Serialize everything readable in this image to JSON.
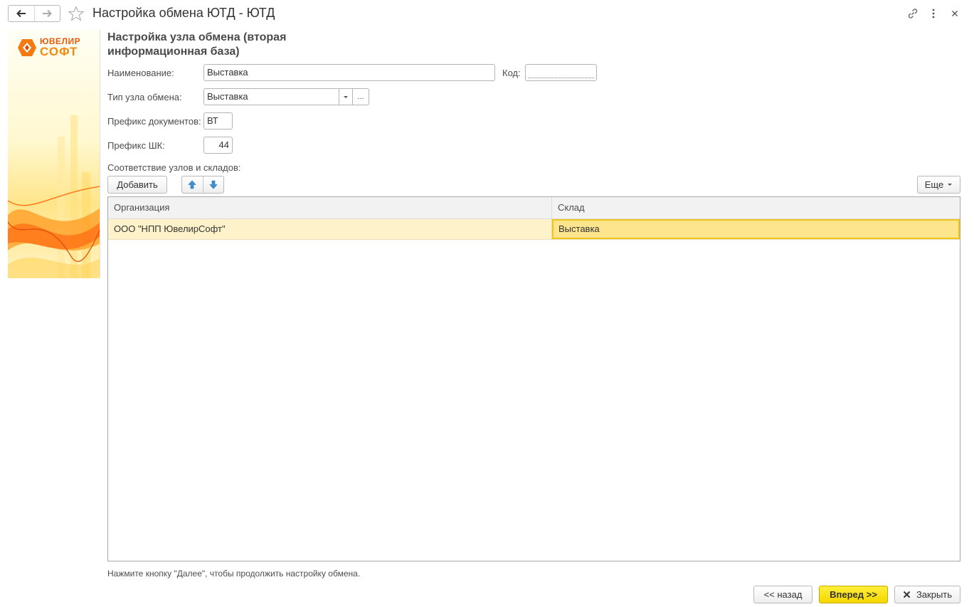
{
  "window": {
    "title": "Настройка обмена ЮТД - ЮТД"
  },
  "logo": {
    "line1": "ЮВЕЛИР",
    "line2": "СОФТ"
  },
  "form": {
    "heading": "Настройка узла обмена (вторая информационная база)",
    "name_label": "Наименование:",
    "name_value": "Выставка",
    "code_label": "Код:",
    "code_value": "",
    "node_type_label": "Тип узла обмена:",
    "node_type_value": "Выставка",
    "node_type_more": "...",
    "doc_prefix_label": "Префикс документов:",
    "doc_prefix_value": "ВТ",
    "barcode_prefix_label": "Префикс ШК:",
    "barcode_prefix_value": "44",
    "mapping_label": "Соответствие узлов и складов:"
  },
  "toolbar": {
    "add_label": "Добавить",
    "more_label": "Еще"
  },
  "table": {
    "columns": [
      "Организация",
      "Склад"
    ],
    "rows": [
      [
        "ООО \"НПП ЮвелирСофт\"",
        "Выставка"
      ]
    ]
  },
  "footer": {
    "hint": "Нажмите кнопку \"Далее\", чтобы продолжить настройку обмена.",
    "back_label": "<< назад",
    "next_label": "Вперед >>",
    "close_label": "Закрыть"
  },
  "colors": {
    "accent_yellow": "#f5d800",
    "selected_row": "#fdf2c9",
    "selected_cell": "#fde58e",
    "brand_orange": "#f08a10"
  }
}
